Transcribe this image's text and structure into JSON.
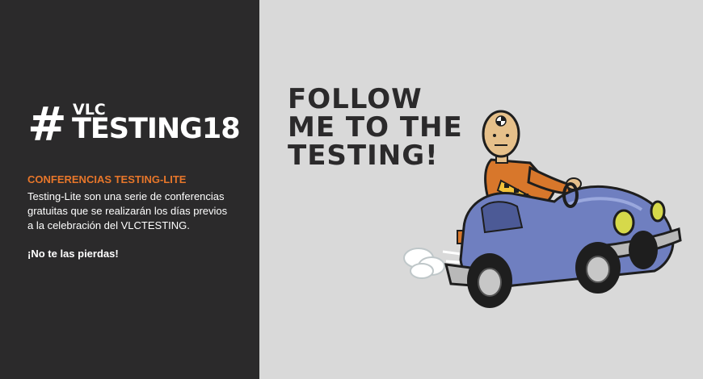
{
  "logo": {
    "hash": "#",
    "small": "VLC",
    "big": "TESTING18"
  },
  "conference": {
    "title": "CONFERENCIAS TESTING-LITE",
    "description": "Testing-Lite son una serie de conferencias\ngratuitas  que se  realizarán los días previos\na la celebración  del VLCTESTING.",
    "cta": "¡No te las pierdas!"
  },
  "headline": {
    "line1": "FOLLOW",
    "line2": "ME TO THE",
    "line3": "TESTING!"
  },
  "colors": {
    "dark_panel": "#2b2a2b",
    "accent_orange": "#e7762a",
    "background": "#d9d9d9",
    "car_blue": "#6f7fc0"
  },
  "illustration": {
    "icon": "crash-test-dummy-car-icon"
  }
}
